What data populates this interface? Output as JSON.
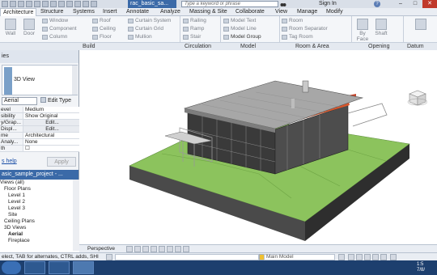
{
  "window": {
    "doc_tab": "rac_basic_sa...",
    "search_placeholder": "Type a keyword or phrase",
    "signin": "Sign In",
    "help": "?",
    "min": "–",
    "max": "□",
    "close": "✕"
  },
  "ribbon_tabs": [
    "Architecture",
    "Structure",
    "Systems",
    "Insert",
    "Annotate",
    "Analyze",
    "Massing & Site",
    "Collaborate",
    "View",
    "Manage",
    "Modify"
  ],
  "ribbon": {
    "wall": "Wall",
    "door": "Door",
    "window": "Window",
    "component": "Component",
    "column": "Column",
    "roof": "Roof",
    "ceiling": "Ceiling",
    "floor": "Floor",
    "curtain_system": "Curtain System",
    "curtain_grid": "Curtain Grid",
    "mullion": "Mullion",
    "railing": "Railing",
    "ramp": "Ramp",
    "stair": "Stair",
    "model_text": "Model Text",
    "model_line": "Model Line",
    "model_group": "Model Group",
    "room": "Room",
    "room_separator": "Room Separator",
    "tag_room": "Tag Room",
    "by_face": "By Face",
    "shaft": "Shaft",
    "panels": [
      "Build",
      "Circulation",
      "Model",
      "Room & Area",
      "Opening",
      "Datum"
    ]
  },
  "properties": {
    "title": "ies",
    "type": "3D View",
    "filter": "Aerial",
    "edit_type": "Edit Type",
    "rows": [
      {
        "k": "evel",
        "v": "Medium"
      },
      {
        "k": "sibility",
        "v": "Show Original"
      },
      {
        "k": "y/Grap...",
        "v": "Edit..."
      },
      {
        "k": "Displ...",
        "v": "Edit..."
      },
      {
        "k": "me",
        "v": "Architectural"
      },
      {
        "k": "Analy...",
        "v": "None"
      },
      {
        "k": "th",
        "v": "☐"
      }
    ],
    "help_link": "s help",
    "apply": "Apply"
  },
  "browser": {
    "title": "asic_sample_project - ...",
    "items": [
      "Views (all)",
      "Floor Plans",
      "Level 1",
      "Level 2",
      "Level 3",
      "Site",
      "Ceiling Plans",
      "3D Views",
      "Aerial",
      "Fireplace"
    ]
  },
  "viewport": {
    "perspective": "Perspective"
  },
  "status": {
    "text": "elect, TAB for alternates, CTRL adds, SHI",
    "model": "Main Model"
  },
  "taskbar": {
    "clock_time": "1:5",
    "clock_date": "7/8/"
  }
}
